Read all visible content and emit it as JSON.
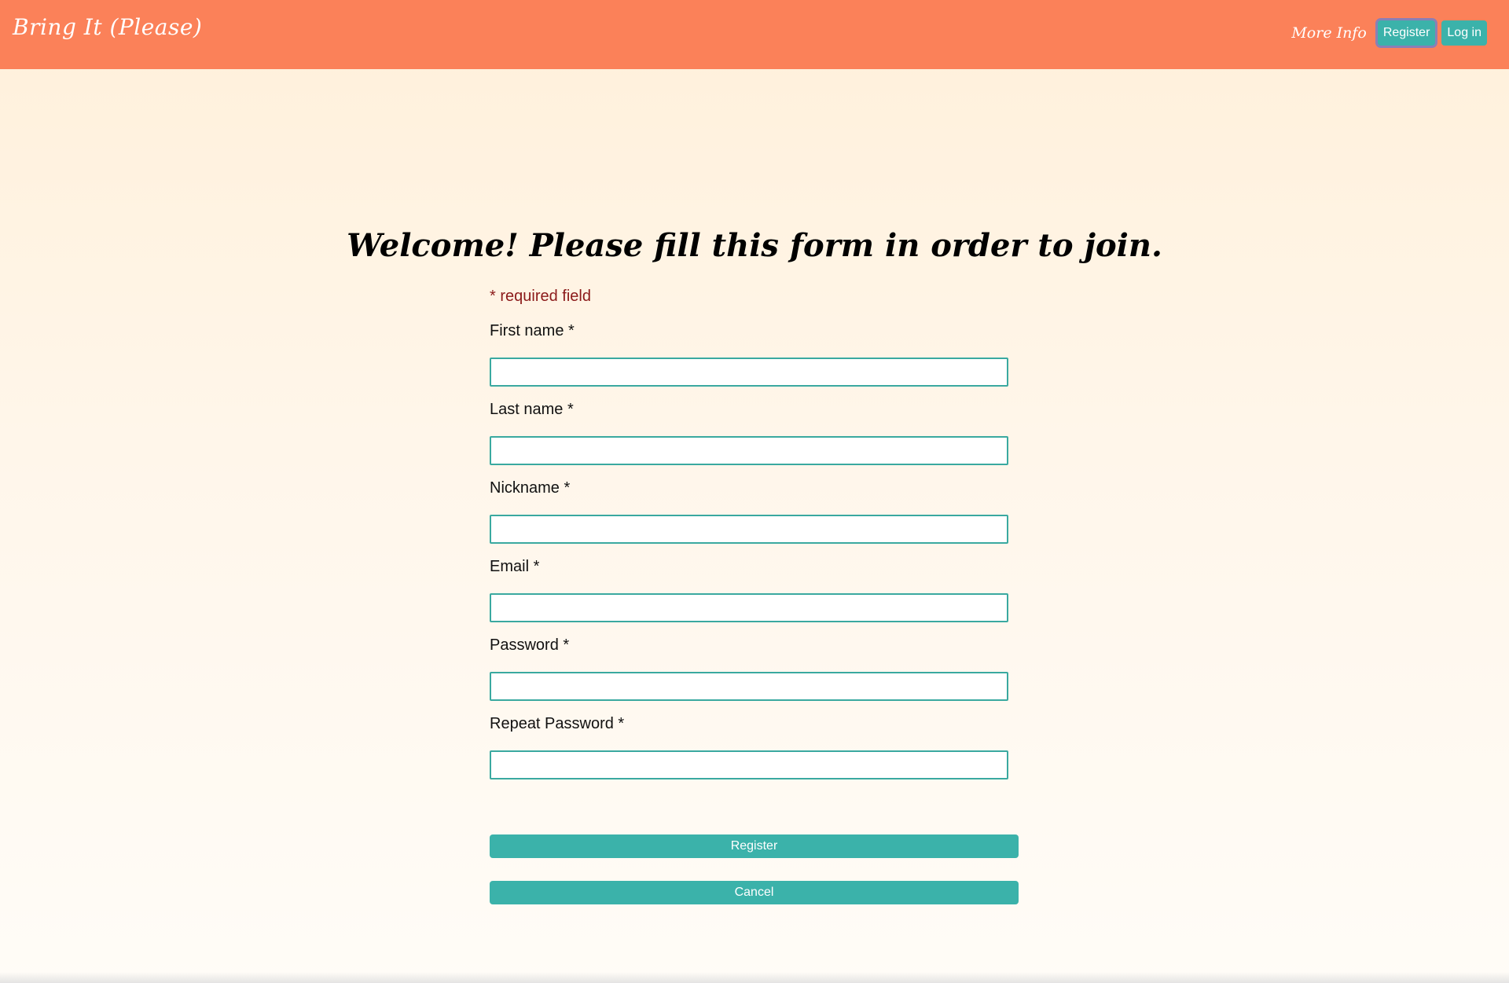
{
  "header": {
    "brand": "Bring It (Please)",
    "nav": {
      "more_info": "More Info",
      "register": "Register",
      "login": "Log in"
    }
  },
  "main": {
    "heading": "Welcome! Please fill this form in order to join.",
    "required_note": "* required field",
    "fields": [
      {
        "label": "First name *",
        "value": ""
      },
      {
        "label": "Last name *",
        "value": ""
      },
      {
        "label": "Nickname *",
        "value": ""
      },
      {
        "label": "Email *",
        "value": ""
      },
      {
        "label": "Password *",
        "value": ""
      },
      {
        "label": "Repeat Password *",
        "value": ""
      }
    ],
    "buttons": {
      "register": "Register",
      "cancel": "Cancel"
    }
  },
  "colors": {
    "header_bg": "#fb8159",
    "accent": "#3bb2aa",
    "required_text": "#8b1a1a",
    "input_border": "#3aa9a0"
  }
}
